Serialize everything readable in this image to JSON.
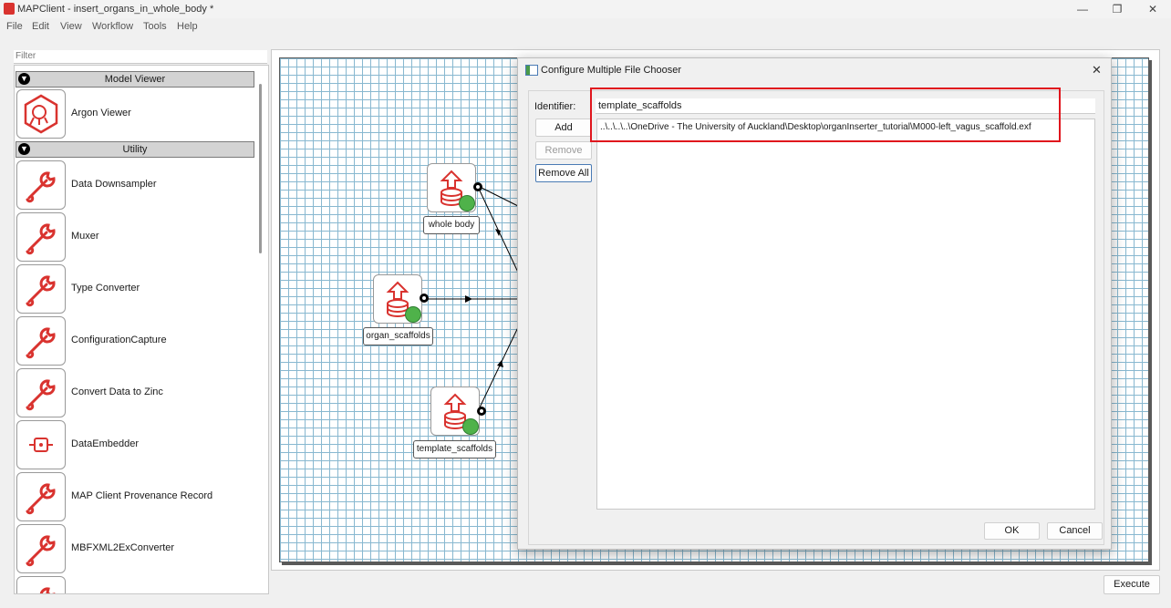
{
  "window": {
    "title": "MAPClient - insert_organs_in_whole_body *",
    "minimize": "—",
    "maximize": "❐",
    "close": "✕"
  },
  "menu": [
    "File",
    "Edit",
    "View",
    "Workflow",
    "Tools",
    "Help"
  ],
  "filter": {
    "placeholder": "Filter"
  },
  "categories": [
    {
      "label": "Model Viewer",
      "items": [
        "Argon Viewer"
      ]
    },
    {
      "label": "Utility",
      "items": [
        "Data Downsampler",
        "Muxer",
        "Type Converter",
        "ConfigurationCapture",
        "Convert Data to Zinc",
        "DataEmbedder",
        "MAP Client Provenance Record",
        "MBFXML2ExConverter"
      ]
    }
  ],
  "workflow": {
    "nodes": [
      "whole body",
      "organ_scaffolds",
      "template_scaffolds"
    ]
  },
  "dialog": {
    "title": "Configure Multiple File Chooser",
    "identifier_label": "Identifier:",
    "identifier_value": "template_scaffolds",
    "add": "Add",
    "remove": "Remove",
    "remove_all": "Remove All",
    "files": [
      "..\\..\\..\\..\\OneDrive - The University of Auckland\\Desktop\\organInserter_tutorial\\M000-left_vagus_scaffold.exf"
    ],
    "ok": "OK",
    "cancel": "Cancel"
  },
  "execute": "Execute",
  "colors": {
    "accent_red": "#e0161d",
    "icon_red": "#d9332f",
    "grid": "#88b8d0",
    "badge_green": "#4fb24a"
  }
}
